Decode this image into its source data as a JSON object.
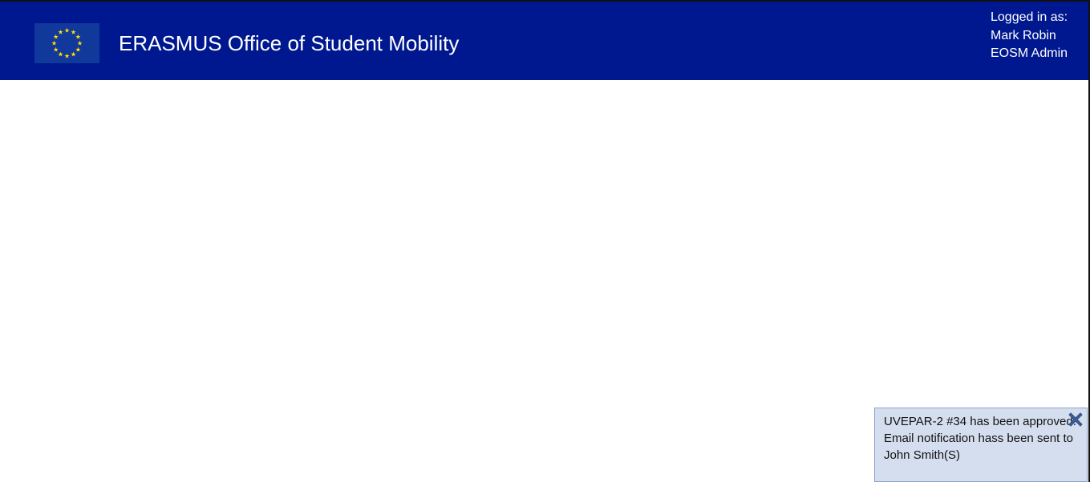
{
  "header": {
    "title": "ERASMUS Office of Student Mobility",
    "logo_icon": "eu-flag-icon"
  },
  "user": {
    "logged_in_label": "Logged in as:",
    "name": "Mark Robin",
    "role": "EOSM Admin"
  },
  "notification": {
    "message": "UVEPAR-2 #34 has been approved. Email notification hass been sent to John Smith(S)",
    "close_icon": "close-icon"
  },
  "colors": {
    "header_bg": "#00188f",
    "flag_bg": "#10399b",
    "flag_star": "#ffdd00",
    "notification_bg": "#d5deef",
    "close_icon": "#3f5f9a"
  }
}
